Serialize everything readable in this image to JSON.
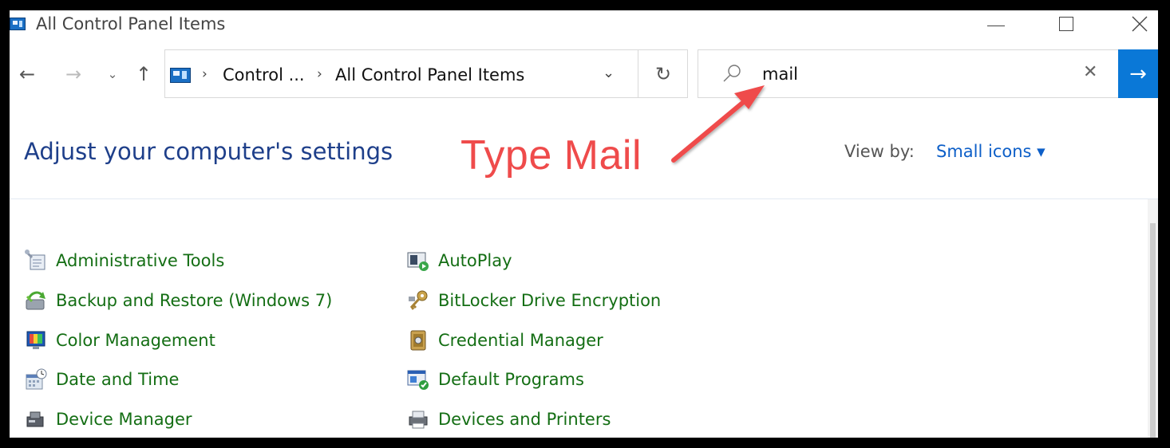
{
  "window": {
    "title": "All Control Panel Items",
    "icon": "control-panel-icon",
    "controls": {
      "minimize": "minimize-icon",
      "maximize": "maximize-icon",
      "close": "close-icon"
    }
  },
  "nav": {
    "back": "←",
    "forward": "→",
    "recent": "⌄",
    "up": "↑"
  },
  "address": {
    "crumbs": [
      "Control ...",
      "All Control Panel Items"
    ],
    "separator": "›",
    "dropdown": "⌄",
    "refresh": "↻"
  },
  "search": {
    "value": "mail",
    "clear": "✕",
    "go": "→"
  },
  "header": {
    "title": "Adjust your computer's settings",
    "view_by_label": "View by:",
    "view_by_value": "Small icons ▾"
  },
  "annotation": {
    "text": "Type Mail",
    "color": "#ef4b4b"
  },
  "items": {
    "col1": [
      {
        "label": "Administrative Tools",
        "icon": "admin-tools-icon"
      },
      {
        "label": "Backup and Restore (Windows 7)",
        "icon": "backup-restore-icon"
      },
      {
        "label": "Color Management",
        "icon": "color-management-icon"
      },
      {
        "label": "Date and Time",
        "icon": "date-time-icon"
      },
      {
        "label": "Device Manager",
        "icon": "device-manager-icon"
      }
    ],
    "col2": [
      {
        "label": "AutoPlay",
        "icon": "autoplay-icon"
      },
      {
        "label": "BitLocker Drive Encryption",
        "icon": "bitlocker-icon"
      },
      {
        "label": "Credential Manager",
        "icon": "credential-manager-icon"
      },
      {
        "label": "Default Programs",
        "icon": "default-programs-icon"
      },
      {
        "label": "Devices and Printers",
        "icon": "devices-printers-icon"
      }
    ]
  },
  "colors": {
    "link_green": "#146e14",
    "title_blue": "#1e3f8a",
    "accent_blue": "#0a78d7"
  }
}
